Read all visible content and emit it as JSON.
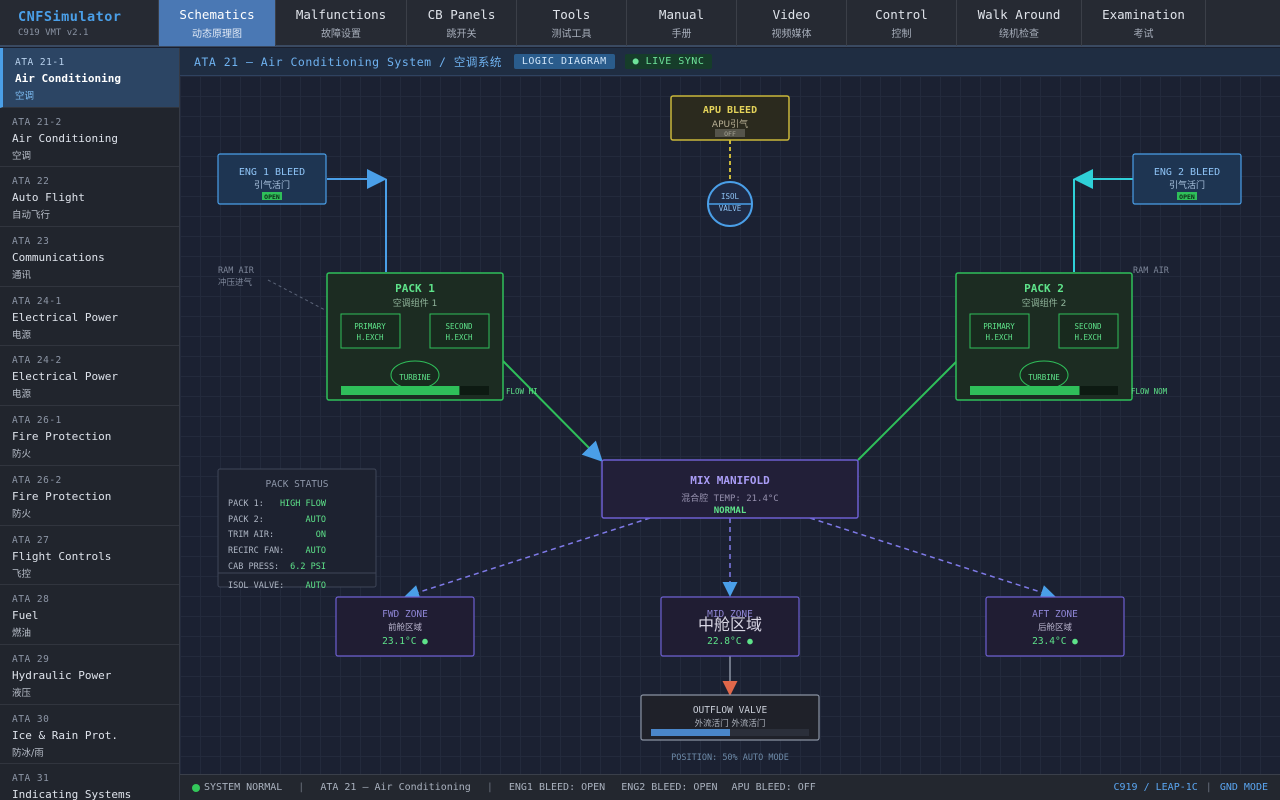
{
  "app": {
    "name": "CNFSimulator",
    "version": "C919 VMT v2.1"
  },
  "tabs": [
    {
      "en": "Schematics",
      "zh": "动态原理图",
      "active": true
    },
    {
      "en": "Malfunctions",
      "zh": "故障设置"
    },
    {
      "en": "CB Panels",
      "zh": "跳开关"
    },
    {
      "en": "Tools",
      "zh": "测试工具"
    },
    {
      "en": "Manual",
      "zh": "手册"
    },
    {
      "en": "Video",
      "zh": "视频媒体"
    },
    {
      "en": "Control",
      "zh": "控制"
    },
    {
      "en": "Walk Around",
      "zh": "绕机检查"
    },
    {
      "en": "Examination",
      "zh": "考试"
    }
  ],
  "sidebar": {
    "items": [
      {
        "code": "ATA 21-1",
        "title": "Air Conditioning",
        "zh": "空调",
        "active": true
      },
      {
        "code": "ATA 21-2",
        "title": "Air Conditioning",
        "zh": "空调"
      },
      {
        "code": "ATA 22",
        "title": "Auto Flight",
        "zh": "自动飞行"
      },
      {
        "code": "ATA 23",
        "title": "Communications",
        "zh": "通讯"
      },
      {
        "code": "ATA 24-1",
        "title": "Electrical Power",
        "zh": "电源"
      },
      {
        "code": "ATA 24-2",
        "title": "Electrical Power",
        "zh": "电源"
      },
      {
        "code": "ATA 26-1",
        "title": "Fire Protection",
        "zh": "防火"
      },
      {
        "code": "ATA 26-2",
        "title": "Fire Protection",
        "zh": "防火"
      },
      {
        "code": "ATA 27",
        "title": "Flight Controls",
        "zh": "飞控"
      },
      {
        "code": "ATA 28",
        "title": "Fuel",
        "zh": "燃油"
      },
      {
        "code": "ATA 29",
        "title": "Hydraulic Power",
        "zh": "液压"
      },
      {
        "code": "ATA 30",
        "title": "Ice & Rain Prot.",
        "zh": "防冰/雨"
      },
      {
        "code": "ATA 31",
        "title": "Indicating Systems",
        "zh": ""
      }
    ]
  },
  "header": {
    "breadcrumb_en": "ATA 21 — Air Conditioning System / ",
    "breadcrumb_zh": "空调系统",
    "badge_logic": "LOGIC DIAGRAM",
    "badge_live": "● LIVE SYNC"
  },
  "diagram": {
    "apu_bleed": {
      "title": "APU BLEED",
      "zh": "APU引气",
      "state": "OFF"
    },
    "isol_valve": {
      "line1": "ISOL",
      "line2": "VALVE"
    },
    "eng1_bleed": {
      "title": "ENG 1 BLEED",
      "zh": "引气活门",
      "state": "OPEN"
    },
    "eng2_bleed": {
      "title": "ENG 2 BLEED",
      "zh": "引气活门",
      "state": "OPEN"
    },
    "ram_air_left": {
      "en": "RAM AIR",
      "zh": "冲压进气"
    },
    "ram_air_right": {
      "en": "RAM AIR"
    },
    "pack1": {
      "title": "PACK 1",
      "zh": "空调组件 1",
      "primary": [
        "PRIMARY",
        "H.EXCH"
      ],
      "second": [
        "SECOND",
        "H.EXCH"
      ],
      "turbine": "TURBINE",
      "flow_label": "FLOW HI",
      "flow_fraction": 0.8
    },
    "pack2": {
      "title": "PACK 2",
      "zh": "空调组件 2",
      "primary": [
        "PRIMARY",
        "H.EXCH"
      ],
      "second": [
        "SECOND",
        "H.EXCH"
      ],
      "turbine": "TURBINE",
      "flow_label": "FLOW NOM",
      "flow_fraction": 0.74
    },
    "mix_manifold": {
      "title": "MIX MANIFOLD",
      "temp": "混合腔 TEMP: 21.4°C",
      "state": "NORMAL"
    },
    "pack_status": {
      "title": "PACK STATUS",
      "rows": [
        {
          "label": "PACK 1:",
          "value": "HIGH FLOW"
        },
        {
          "label": "PACK 2:",
          "value": "AUTO"
        },
        {
          "label": "TRIM AIR:",
          "value": "ON"
        },
        {
          "label": "RECIRC FAN:",
          "value": "AUTO"
        },
        {
          "label": "CAB PRESS:",
          "value": "6.2 PSI"
        },
        {
          "label": "ISOL VALVE:",
          "value": "AUTO"
        }
      ]
    },
    "fwd_zone": {
      "title": "FWD ZONE",
      "zh": "前舱区域",
      "temp": "23.1°C ●"
    },
    "mid_zone": {
      "title": "MID ZONE",
      "zh": "中舱区域",
      "temp": "22.8°C ●"
    },
    "aft_zone": {
      "title": "AFT ZONE",
      "zh": "后舱区域",
      "temp": "23.4°C ●"
    },
    "outflow_valve": {
      "title": "OUTFLOW VALVE",
      "zh": "外流活门 外流活门",
      "position_fraction": 0.5,
      "position_text": "POSITION: 50% AUTO MODE"
    }
  },
  "statusbar": {
    "system": "SYSTEM NORMAL",
    "sep": "|",
    "ata": "ATA 21 — Air Conditioning",
    "eng1": "ENG1 BLEED: OPEN",
    "eng2": "ENG2 BLEED: OPEN",
    "apu": "APU BLEED: OFF",
    "aircraft": "C919 / LEAP-1C",
    "mode": "GND MODE"
  },
  "colors": {
    "pack_green": "#2fbf5a",
    "manifold_purple": "#6c5fd0",
    "bleed_blue": "#4a9fe8",
    "eng2_cyan": "#2fd0d8",
    "apu_yellow": "#c9b73a",
    "outflow_arrow": "#e0674a"
  }
}
